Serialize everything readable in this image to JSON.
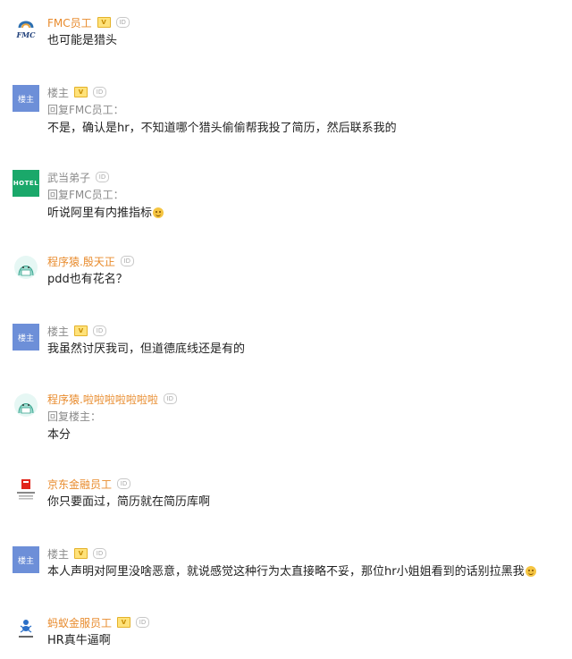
{
  "comments": [
    {
      "name": "FMC员工",
      "avatar_text": "FMC",
      "text": "也可能是猎头"
    },
    {
      "name": "楼主",
      "avatar_text": "楼主",
      "reply": "回复FMC员工：",
      "text": "不是，确认是hr，不知道哪个猎头偷偷帮我投了简历，然后联系我的"
    },
    {
      "name": "武当弟子",
      "avatar_text": "HOTEL",
      "reply": "回复FMC员工：",
      "text": "听说阿里有内推指标"
    },
    {
      "name": "程序猿.殷天正",
      "text": "pdd也有花名？"
    },
    {
      "name": "楼主",
      "avatar_text": "楼主",
      "text": "我虽然讨厌我司，但道德底线还是有的"
    },
    {
      "name": "程序猿.啦啦啦啦啦啦啦",
      "reply": "回复楼主：",
      "text": "本分"
    },
    {
      "name": "京东金融员工",
      "text": "你只要面过，简历就在简历库啊"
    },
    {
      "name": "楼主",
      "avatar_text": "楼主",
      "text": "本人声明对阿里没啥恶意，就说感觉这种行为太直接略不妥，那位hr小姐姐看到的话别拉黑我"
    },
    {
      "name": "蚂蚁金服员工",
      "text": "HR真牛逼啊"
    }
  ],
  "badges": {
    "v": "V",
    "id": "ID"
  },
  "colors": {
    "name_orange": "#e88b2d",
    "name_gray": "#8a8a8a",
    "louzhu_avatar": "#6d8fd8",
    "hotel_avatar": "#1aa86a"
  }
}
